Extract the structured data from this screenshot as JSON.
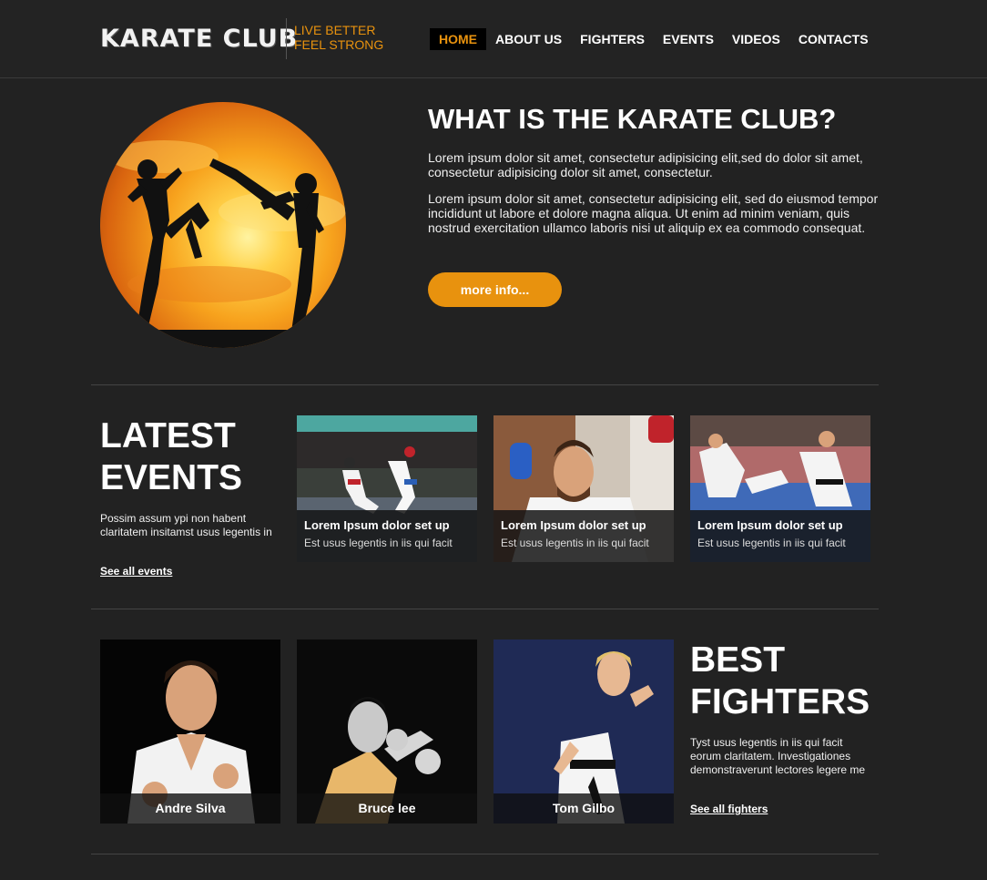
{
  "header": {
    "logo": "KARATE CLUB",
    "tagline_line1": "LIVE BETTER",
    "tagline_line2": "FEEL STRONG",
    "accent_color": "#e8920e",
    "nav": [
      {
        "label": "HOME",
        "active": true
      },
      {
        "label": "ABOUT US",
        "active": false
      },
      {
        "label": "FIGHTERS",
        "active": false
      },
      {
        "label": "EVENTS",
        "active": false
      },
      {
        "label": "VIDEOS",
        "active": false
      },
      {
        "label": "CONTACTS",
        "active": false
      }
    ]
  },
  "intro": {
    "title": "WHAT IS THE KARATE CLUB?",
    "paragraph1": "Lorem ipsum dolor sit amet, consectetur adipisicing elit,sed do dolor sit amet, consectetur adipisicing dolor sit amet, consectetur.",
    "paragraph2": "Lorem ipsum dolor sit amet, consectetur adipisicing elit, sed do eiusmod tempor incididunt ut labore et dolore magna aliqua. Ut enim ad minim veniam, quis nostrud exercitation ullamco laboris nisi ut aliquip ex ea commodo consequat.",
    "button_label": "more info..."
  },
  "events": {
    "title_line1": "LATEST",
    "title_line2": "EVENTS",
    "description": "Possim assum ypi non habent claritatem insitamst usus legentis in",
    "link": "See all events",
    "cards": [
      {
        "title": "Lorem Ipsum dolor set up",
        "subtitle": "Est usus legentis in iis qui facit"
      },
      {
        "title": "Lorem Ipsum dolor set up",
        "subtitle": "Est usus legentis in iis qui facit"
      },
      {
        "title": "Lorem Ipsum dolor set up",
        "subtitle": "Est usus legentis in iis qui facit"
      }
    ]
  },
  "fighters": {
    "title_line1": "BEST",
    "title_line2": "FIGHTERS",
    "description": "Tyst usus legentis in iis qui facit eorum claritatem. Investigationes demonstraverunt lectores legere me",
    "link": "See all fighters",
    "people": [
      {
        "name": "Andre Silva"
      },
      {
        "name": "Bruce lee"
      },
      {
        "name": "Tom Gilbo"
      }
    ]
  }
}
